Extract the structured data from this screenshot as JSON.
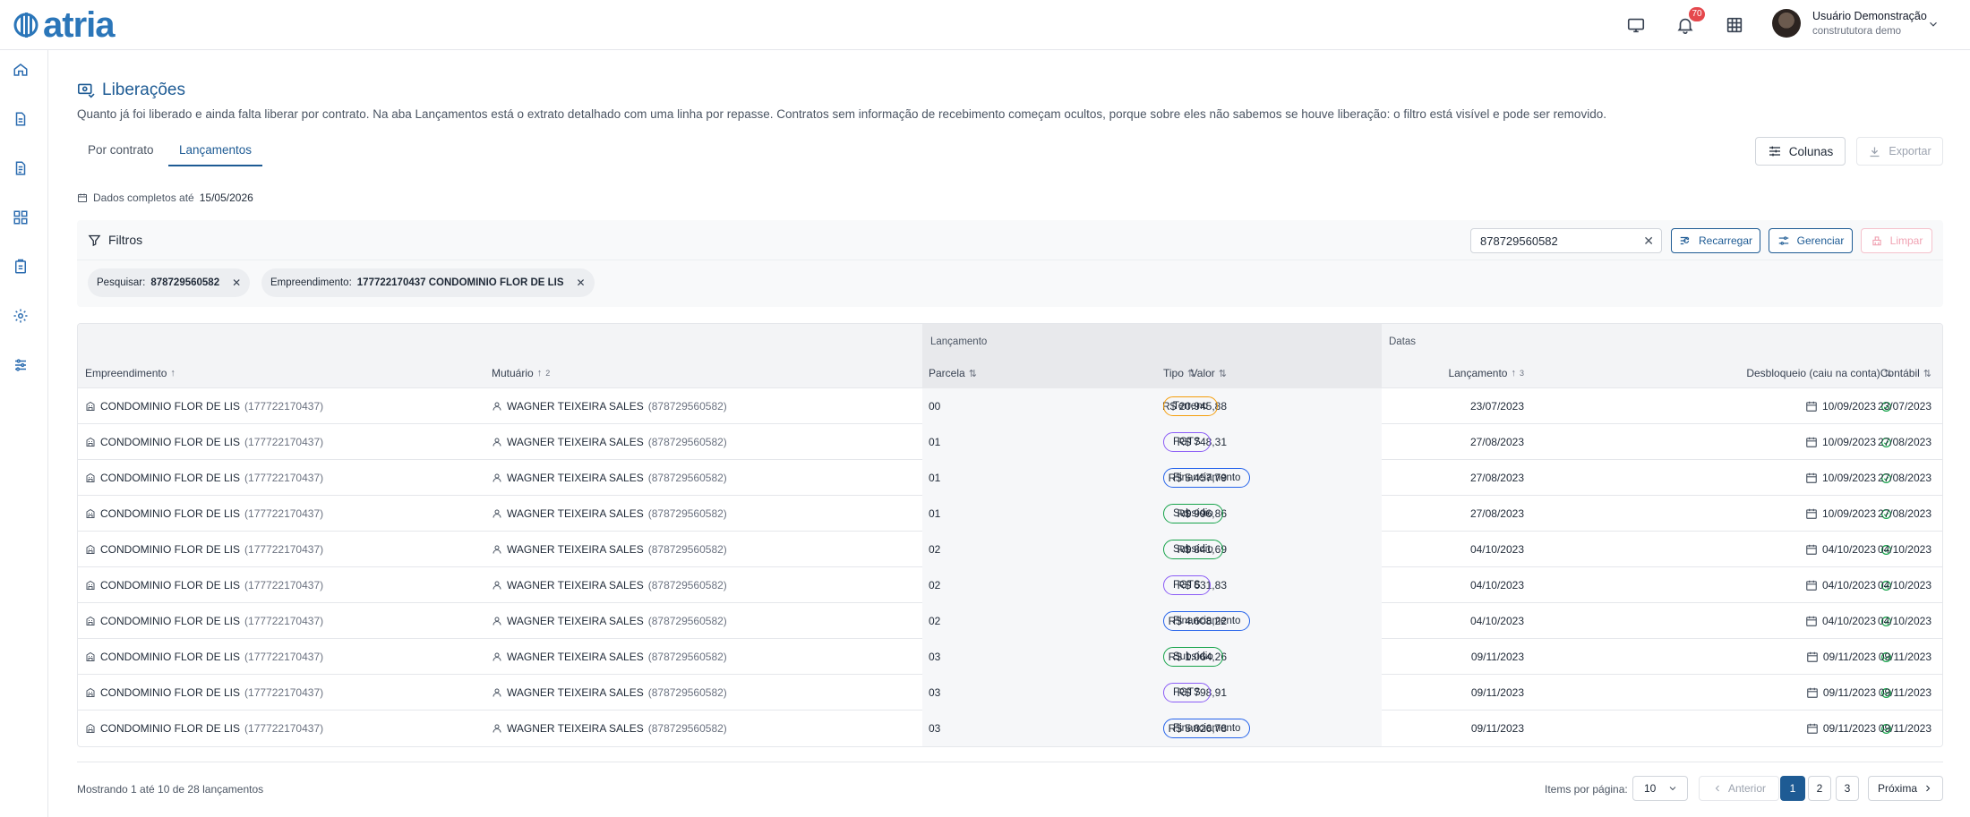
{
  "brand": {
    "name": "atria",
    "color": "#2b76b9"
  },
  "topbar": {
    "icons": [
      "monitor-icon",
      "bell-icon",
      "grid-icon"
    ],
    "notifications_count": "70",
    "user": {
      "name": "Usuário Demonstração",
      "org": "constrututora demo"
    }
  },
  "sidebar": {
    "items": [
      "home-icon",
      "document-icon",
      "file-text-icon",
      "dashboard-icon",
      "clipboard-icon",
      "gear-icon",
      "sliders-icon"
    ]
  },
  "page": {
    "title": "Liberações",
    "description": "Quanto já foi liberado e ainda falta liberar por contrato. Na aba Lançamentos está o extrato detalhado com uma linha por repasse. Contratos sem informação de recebimento começam ocultos, porque sobre eles não sabemos se houve liberação: o filtro está visível e pode ser removido."
  },
  "tabs": [
    {
      "label": "Por contrato",
      "active": false
    },
    {
      "label": "Lançamentos",
      "active": true
    }
  ],
  "toolbar": {
    "columns_label": "Colunas",
    "export_label": "Exportar"
  },
  "data_note": {
    "prefix": "Dados completos até",
    "date": "15/05/2026"
  },
  "filters": {
    "title": "Filtros",
    "search_value": "878729560582",
    "reload_label": "Recarregar",
    "manage_label": "Gerenciar",
    "clear_label": "Limpar",
    "chips": [
      {
        "key": "Pesquisar:",
        "value": "878729560582"
      },
      {
        "key": "Empreendimento:",
        "value": "177722170437 CONDOMINIO FLOR DE LIS"
      }
    ]
  },
  "table": {
    "groups": {
      "lancamento": "Lançamento",
      "datas": "Datas"
    },
    "columns": {
      "empreendimento": "Empreendimento",
      "mutuario": "Mutuário",
      "mutuario_sort_n": "2",
      "parcela": "Parcela",
      "valor": "Valor",
      "tipo": "Tipo",
      "lancamento": "Lançamento",
      "lancamento_sort_n": "3",
      "desbloqueio": "Desbloqueio (caiu na conta)",
      "contabil": "Contábil"
    },
    "tag_colors": {
      "Terreno": "#f59e0b",
      "FGTS": "#8b5cf6",
      "Financiamento": "#2563eb",
      "Subsídio": "#16a34a"
    },
    "rows": [
      {
        "emp": "CONDOMINIO FLOR DE LIS",
        "emp_id": "(177722170437)",
        "mut": "WAGNER TEIXEIRA SALES",
        "mut_id": "(878729560582)",
        "parcela": "00",
        "valor": "R$ 20.945,88",
        "tipo": "Terreno",
        "lanc": "23/07/2023",
        "desb": "10/09/2023",
        "cont": "23/07/2023"
      },
      {
        "emp": "CONDOMINIO FLOR DE LIS",
        "emp_id": "(177722170437)",
        "mut": "WAGNER TEIXEIRA SALES",
        "mut_id": "(878729560582)",
        "parcela": "01",
        "valor": "R$ 748,31",
        "tipo": "FGTS",
        "lanc": "27/08/2023",
        "desb": "10/09/2023",
        "cont": "27/08/2023"
      },
      {
        "emp": "CONDOMINIO FLOR DE LIS",
        "emp_id": "(177722170437)",
        "mut": "WAGNER TEIXEIRA SALES",
        "mut_id": "(878729560582)",
        "parcela": "01",
        "valor": "R$ 5.457,79",
        "tipo": "Financiamento",
        "lanc": "27/08/2023",
        "desb": "10/09/2023",
        "cont": "27/08/2023"
      },
      {
        "emp": "CONDOMINIO FLOR DE LIS",
        "emp_id": "(177722170437)",
        "mut": "WAGNER TEIXEIRA SALES",
        "mut_id": "(878729560582)",
        "parcela": "01",
        "valor": "R$ 996,86",
        "tipo": "Subsídio",
        "lanc": "27/08/2023",
        "desb": "10/09/2023",
        "cont": "27/08/2023"
      },
      {
        "emp": "CONDOMINIO FLOR DE LIS",
        "emp_id": "(177722170437)",
        "mut": "WAGNER TEIXEIRA SALES",
        "mut_id": "(878729560582)",
        "parcela": "02",
        "valor": "R$ 841,69",
        "tipo": "Subsídio",
        "lanc": "04/10/2023",
        "desb": "04/10/2023",
        "cont": "04/10/2023"
      },
      {
        "emp": "CONDOMINIO FLOR DE LIS",
        "emp_id": "(177722170437)",
        "mut": "WAGNER TEIXEIRA SALES",
        "mut_id": "(878729560582)",
        "parcela": "02",
        "valor": "R$ 631,83",
        "tipo": "FGTS",
        "lanc": "04/10/2023",
        "desb": "04/10/2023",
        "cont": "04/10/2023"
      },
      {
        "emp": "CONDOMINIO FLOR DE LIS",
        "emp_id": "(177722170437)",
        "mut": "WAGNER TEIXEIRA SALES",
        "mut_id": "(878729560582)",
        "parcela": "02",
        "valor": "R$ 4.608,22",
        "tipo": "Financiamento",
        "lanc": "04/10/2023",
        "desb": "04/10/2023",
        "cont": "04/10/2023"
      },
      {
        "emp": "CONDOMINIO FLOR DE LIS",
        "emp_id": "(177722170437)",
        "mut": "WAGNER TEIXEIRA SALES",
        "mut_id": "(878729560582)",
        "parcela": "03",
        "valor": "R$ 1.064,26",
        "tipo": "Subsídio",
        "lanc": "09/11/2023",
        "desb": "09/11/2023",
        "cont": "09/11/2023"
      },
      {
        "emp": "CONDOMINIO FLOR DE LIS",
        "emp_id": "(177722170437)",
        "mut": "WAGNER TEIXEIRA SALES",
        "mut_id": "(878729560582)",
        "parcela": "03",
        "valor": "R$ 798,91",
        "tipo": "FGTS",
        "lanc": "09/11/2023",
        "desb": "09/11/2023",
        "cont": "09/11/2023"
      },
      {
        "emp": "CONDOMINIO FLOR DE LIS",
        "emp_id": "(177722170437)",
        "mut": "WAGNER TEIXEIRA SALES",
        "mut_id": "(878729560582)",
        "parcela": "03",
        "valor": "R$ 5.826,78",
        "tipo": "Financiamento",
        "lanc": "09/11/2023",
        "desb": "09/11/2023",
        "cont": "09/11/2023"
      }
    ]
  },
  "footer": {
    "showing": "Mostrando 1 até 10 de 28 lançamentos",
    "items_per_page_label": "Items por página:",
    "items_per_page": "10",
    "prev_label": "Anterior",
    "next_label": "Próxima",
    "pages": [
      "1",
      "2",
      "3"
    ],
    "current_page": "1"
  }
}
